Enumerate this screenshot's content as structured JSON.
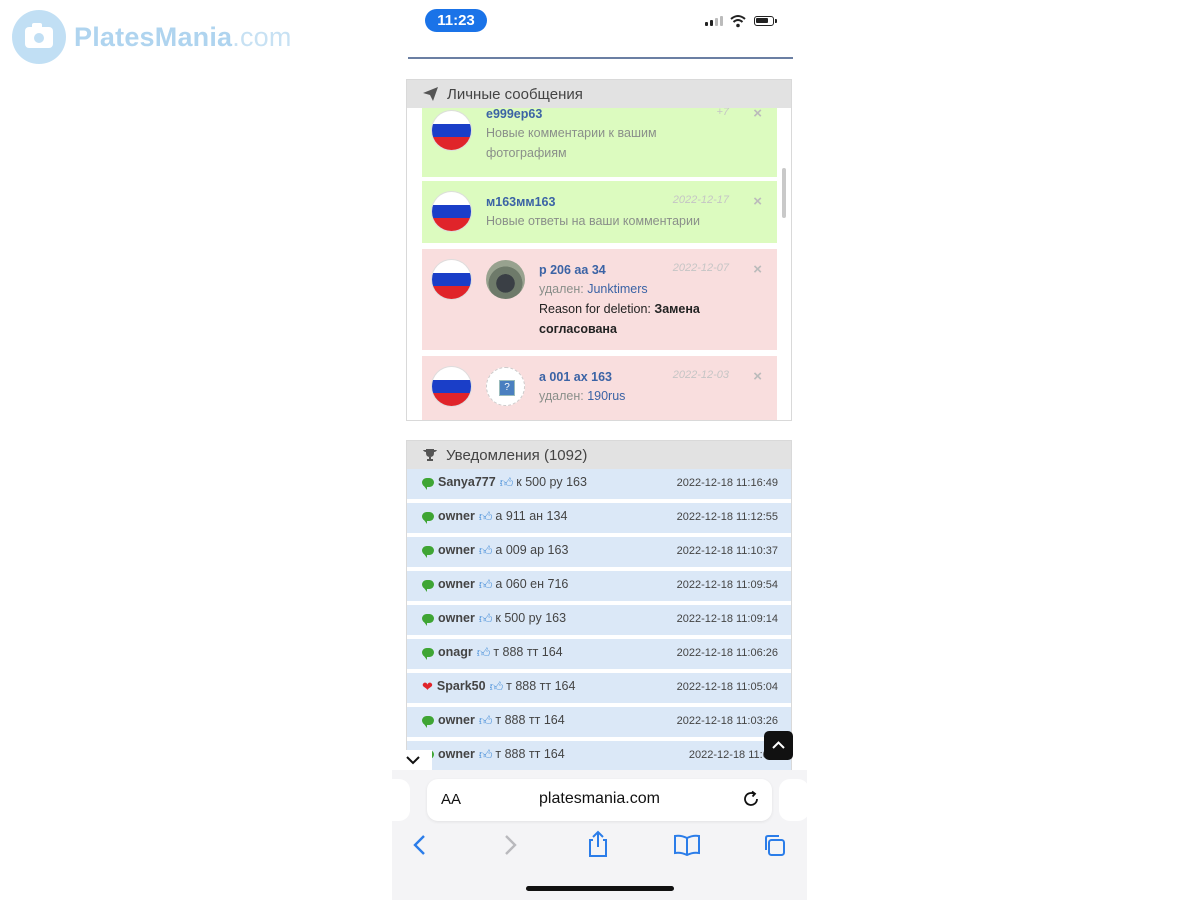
{
  "watermark": {
    "brand": "PlatesMania",
    "domain": ".com"
  },
  "status_bar": {
    "time": "11:23"
  },
  "messages_panel": {
    "title": "Личные сообщения",
    "items": [
      {
        "plate": "е999ер63",
        "text": "Новые комментарии к вашим фотографиям",
        "date": "+7",
        "style": "green"
      },
      {
        "plate": "м163мм163",
        "text": "Новые ответы на ваши комментарии",
        "date": "2022-12-17",
        "style": "green"
      },
      {
        "plate": "р 206 аа 34",
        "deleted_label": "удален:",
        "deleted_by": "Junktimers",
        "reason_label": "Reason for deletion:",
        "reason": "Замена согласована",
        "date": "2022-12-07",
        "style": "red"
      },
      {
        "plate": "а 001 ах 163",
        "deleted_label": "удален:",
        "deleted_by": "190rus",
        "date": "2022-12-03",
        "style": "red"
      }
    ]
  },
  "notifications_panel": {
    "title": "Уведомления (1092)",
    "items": [
      {
        "type": "comment",
        "user": "Sanya777",
        "plate": "к 500 ру 163",
        "datetime": "2022-12-18 11:16:49"
      },
      {
        "type": "comment",
        "user": "owner",
        "plate": "а 911 ан 134",
        "datetime": "2022-12-18 11:12:55"
      },
      {
        "type": "comment",
        "user": "owner",
        "plate": "а 009 ар 163",
        "datetime": "2022-12-18 11:10:37"
      },
      {
        "type": "comment",
        "user": "owner",
        "plate": "а 060 ен 716",
        "datetime": "2022-12-18 11:09:54"
      },
      {
        "type": "comment",
        "user": "owner",
        "plate": "к 500 ру 163",
        "datetime": "2022-12-18 11:09:14"
      },
      {
        "type": "comment",
        "user": "onagr",
        "plate": "т 888 тт 164",
        "datetime": "2022-12-18 11:06:26"
      },
      {
        "type": "like",
        "user": "Spark50",
        "plate": "т 888 тт 164",
        "datetime": "2022-12-18 11:05:04"
      },
      {
        "type": "comment",
        "user": "owner",
        "plate": "т 888 тт 164",
        "datetime": "2022-12-18 11:03:26"
      },
      {
        "type": "comment",
        "user": "owner",
        "plate": "т 888 тт 164",
        "datetime": "2022-12-18 11:03:"
      }
    ]
  },
  "browser": {
    "aa_label": "AA",
    "url": "platesmania.com"
  },
  "icons": {
    "send": "paper-plane-icon",
    "trophy": "trophy-icon",
    "comment": "comment-bubble-icon",
    "like": "heart-icon",
    "thumb": "thumbs-up-icon",
    "close": "close-icon",
    "back": "back-chevron-icon",
    "forward": "forward-chevron-icon",
    "share": "share-icon",
    "bookmarks": "book-icon",
    "tabs": "tabs-icon",
    "reload": "reload-icon"
  },
  "colors": {
    "accent": "#1a73e8",
    "link": "#3b63a5",
    "green_row": "#dcfbbf",
    "red_row": "#f9dede",
    "notif_row": "#dbe8f7"
  }
}
